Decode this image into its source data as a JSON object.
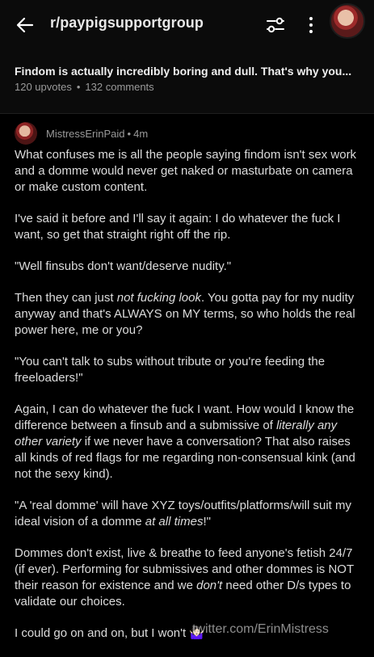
{
  "header": {
    "subreddit": "r/paypigsupportgroup",
    "back_icon": "back-arrow-icon",
    "filter_icon": "sort-filter-icon",
    "more_icon": "more-vertical-icon"
  },
  "post": {
    "title": "Findom is actually incredibly boring and dull. That's why you...",
    "upvotes": "120 upvotes",
    "dot": "•",
    "comments": "132 comments"
  },
  "comment": {
    "author": "MistressErinPaid",
    "separator": "•",
    "time": "4m",
    "p1": "What confuses me is all the people saying findom isn't sex work and a domme would never get naked or masturbate on camera or make custom content.",
    "p2": "I've said it before and I'll say it again: I do whatever the fuck I want, so get that straight right off the rip.",
    "p3": "\"Well finsubs don't want/deserve nudity.\"",
    "p4a": "Then they can just ",
    "p4b": "not fucking look",
    "p4c": ". You gotta pay for my nudity anyway and that's ALWAYS on MY terms, so who holds the real power here, me or you?",
    "p5": "\"You can't talk to subs without tribute or you're feeding the freeloaders!\"",
    "p6a": "Again, I can do whatever the fuck I want. How would I know the difference between a finsub and a submissive of ",
    "p6b": "literally any other variety",
    "p6c": " if we never have a conversation? That also raises all kinds of red flags for me regarding non-consensual kink (and not the sexy kind).",
    "p7a": "\"A 'real domme' will have XYZ toys/outfits/platforms/will suit my ideal vision of a domme ",
    "p7b": "at all times",
    "p7c": "!\"",
    "p8a": "Dommes don't exist, live & breathe to feed anyone's fetish 24/7 (if ever). Performing for submissives and other dommes is NOT their reason for existence and we ",
    "p8b": "don't",
    "p8c": " need other D/s types to validate our choices.",
    "p9": "I could go on and on, but I won't 🤷🏻‍♀️"
  },
  "watermark": "twitter.com/ErinMistress"
}
